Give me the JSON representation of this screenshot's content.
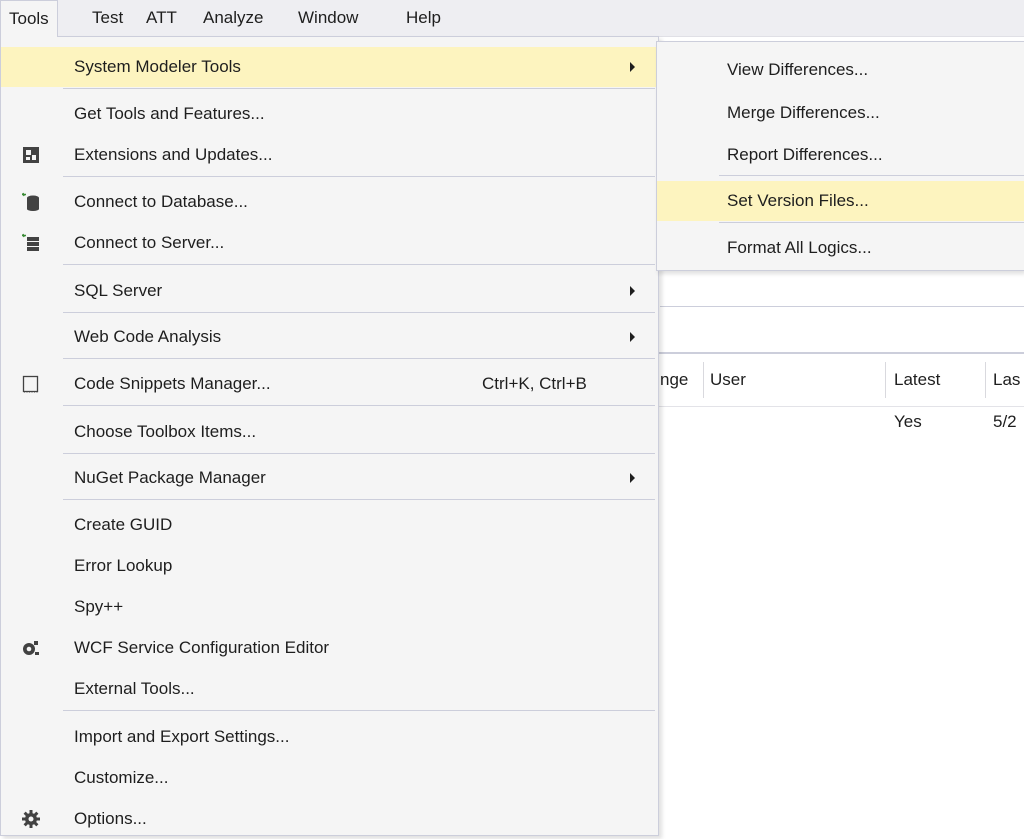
{
  "menubar": {
    "items": [
      {
        "label": "Tools"
      },
      {
        "label": "Test"
      },
      {
        "label": "ATT"
      },
      {
        "label": "Analyze"
      },
      {
        "label": "Window"
      },
      {
        "label": "Help"
      }
    ]
  },
  "tools_menu": {
    "items": [
      {
        "label": "System Modeler Tools",
        "submenu": true,
        "highlighted": true
      },
      {
        "label": "Get Tools and Features..."
      },
      {
        "label": "Extensions and Updates...",
        "icon": "extensions-icon"
      },
      {
        "label": "Connect to Database...",
        "icon": "database-connect-icon"
      },
      {
        "label": "Connect to Server...",
        "icon": "server-connect-icon"
      },
      {
        "label": "SQL Server",
        "submenu": true
      },
      {
        "label": "Web Code Analysis",
        "submenu": true
      },
      {
        "label": "Code Snippets Manager...",
        "shortcut": "Ctrl+K, Ctrl+B",
        "icon": "snippet-icon"
      },
      {
        "label": "Choose Toolbox Items..."
      },
      {
        "label": "NuGet Package Manager",
        "submenu": true
      },
      {
        "label": "Create GUID"
      },
      {
        "label": "Error Lookup"
      },
      {
        "label": "Spy++"
      },
      {
        "label": "WCF Service Configuration Editor",
        "icon": "wcf-config-icon"
      },
      {
        "label": "External Tools..."
      },
      {
        "label": "Import and Export Settings..."
      },
      {
        "label": "Customize..."
      },
      {
        "label": "Options...",
        "icon": "gear-icon"
      }
    ]
  },
  "system_modeler_submenu": {
    "items": [
      {
        "label": "View Differences..."
      },
      {
        "label": "Merge Differences..."
      },
      {
        "label": "Report Differences..."
      },
      {
        "label": "Set Version Files...",
        "highlighted": true
      },
      {
        "label": "Format All Logics..."
      }
    ]
  },
  "background_table": {
    "headers": [
      "nge",
      "User",
      "Latest",
      "Las"
    ],
    "row": {
      "latest": "Yes",
      "last": "5/2"
    }
  },
  "colors": {
    "highlight": "#fdf4bf",
    "menu_bg": "#f5f5f5",
    "border": "#cccedb",
    "menubar_bg": "#eeeef2"
  }
}
